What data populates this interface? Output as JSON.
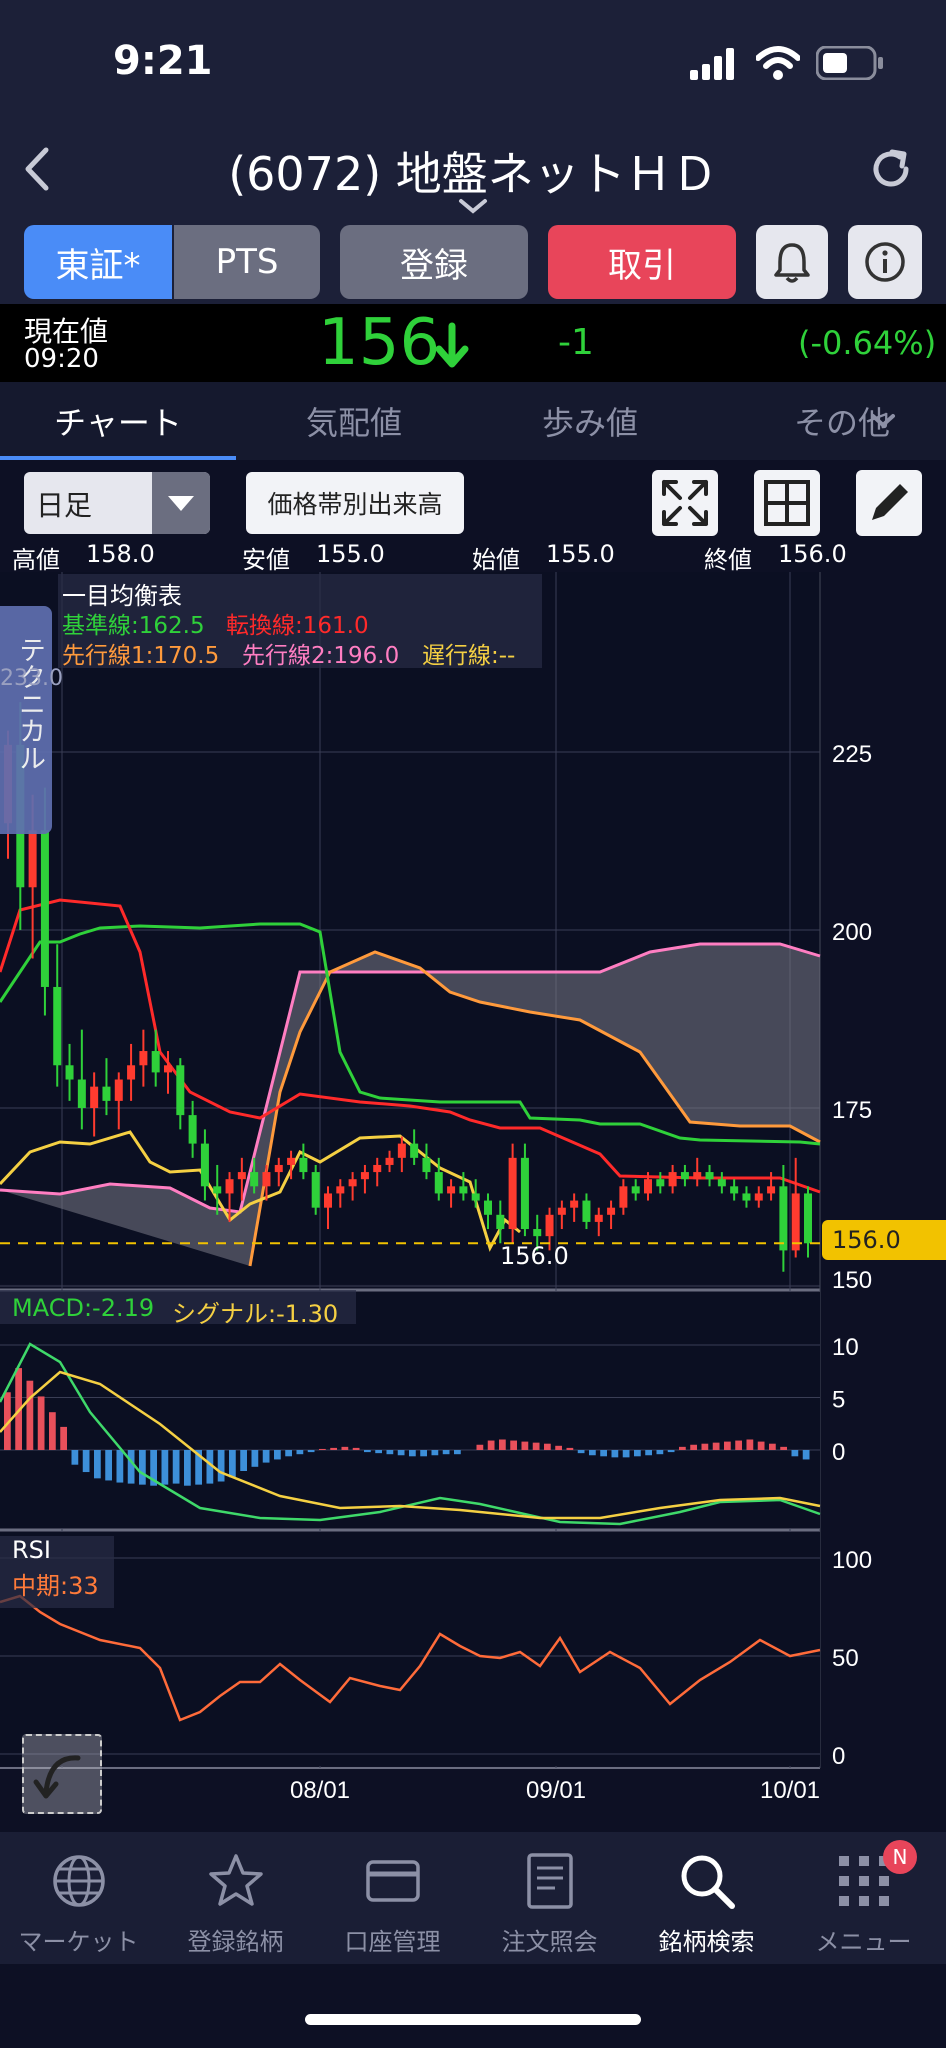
{
  "status_bar": {
    "time": "9:21"
  },
  "header": {
    "title": "(6072) 地盤ネットＨＤ"
  },
  "buttons": {
    "market": "東証*",
    "pts": "PTS",
    "register": "登録",
    "trade": "取引"
  },
  "price": {
    "label": "現在値",
    "time": "09:20",
    "value": "156",
    "change": "-1",
    "change_pct": "(-0.64%)"
  },
  "tabs": [
    "チャート",
    "気配値",
    "歩み値",
    "その他"
  ],
  "toolbar": {
    "period": "日足",
    "volume_btn": "価格帯別出来高"
  },
  "ohlc": {
    "high_label": "高値",
    "high": "158.0",
    "low_label": "安値",
    "low": "155.0",
    "open_label": "始値",
    "open": "155.0",
    "close_label": "終値",
    "close": "156.0"
  },
  "ichimoku": {
    "title": "一目均衡表",
    "kijun": "基準線:162.5",
    "tenkan": "転換線:161.0",
    "senkou1": "先行線1:170.5",
    "senkou2": "先行線2:196.0",
    "chikou": "遅行線:--"
  },
  "side_tab": {
    "label": "テクニカル",
    "value": "233.0"
  },
  "main_axis": [
    "225",
    "200",
    "175",
    "150"
  ],
  "current_price_tag": "156.0",
  "low_annotation": "156.0",
  "macd": {
    "label": "MACD:-2.19",
    "signal": "シグナル:-1.30",
    "axis": [
      "10",
      "5",
      "0"
    ]
  },
  "rsi": {
    "label": "RSI",
    "mid": "中期:33",
    "axis": [
      "100",
      "50",
      "0"
    ]
  },
  "x_labels": [
    "08/01",
    "09/01",
    "10/01"
  ],
  "bottom_nav": [
    {
      "label": "マーケット",
      "icon": "globe-icon"
    },
    {
      "label": "登録銘柄",
      "icon": "star-icon"
    },
    {
      "label": "口座管理",
      "icon": "card-icon"
    },
    {
      "label": "注文照会",
      "icon": "document-icon"
    },
    {
      "label": "銘柄検索",
      "icon": "search-icon"
    },
    {
      "label": "メニュー",
      "icon": "menu-grid-icon"
    }
  ],
  "menu_badge": "N",
  "colors": {
    "up": "#ff3b2f",
    "down": "#2fd13a",
    "kijun": "#2fd13a",
    "tenkan": "#ff2a2a",
    "senkou1": "#ff9a3c",
    "senkou2": "#ff7ec2",
    "chikou": "#f5d043",
    "macd_pos": "#e8505b",
    "macd_neg": "#3d8fd9",
    "accent_blue": "#4a8cf7",
    "trade_red": "#e8455a"
  },
  "chart_data": {
    "type": "candlestick",
    "ylim": [
      148,
      240
    ],
    "x_labels": [
      "08/01",
      "09/01",
      "10/01"
    ],
    "candles": [
      [
        215,
        228,
        210,
        226
      ],
      [
        226,
        232,
        200,
        206
      ],
      [
        206,
        219,
        196,
        214
      ],
      [
        214,
        220,
        188,
        192
      ],
      [
        192,
        198,
        178,
        181
      ],
      [
        181,
        184,
        176,
        179
      ],
      [
        179,
        186,
        172,
        175
      ],
      [
        175,
        180,
        171,
        178
      ],
      [
        178,
        182,
        174,
        176
      ],
      [
        176,
        180,
        172,
        179
      ],
      [
        179,
        184,
        176,
        181
      ],
      [
        181,
        186,
        178,
        183
      ],
      [
        183,
        186,
        178,
        180
      ],
      [
        180,
        183,
        177,
        181
      ],
      [
        181,
        182,
        172,
        174
      ],
      [
        174,
        176,
        168,
        170
      ],
      [
        170,
        172,
        162,
        164
      ],
      [
        164,
        167,
        160,
        163
      ],
      [
        163,
        166,
        159,
        165
      ],
      [
        165,
        168,
        162,
        166
      ],
      [
        166,
        168,
        163,
        164
      ],
      [
        164,
        167,
        162,
        166
      ],
      [
        166,
        168,
        164,
        167
      ],
      [
        167,
        169,
        165,
        168
      ],
      [
        168,
        170,
        165,
        166
      ],
      [
        166,
        167,
        160,
        161
      ],
      [
        161,
        164,
        158,
        163
      ],
      [
        163,
        165,
        161,
        164
      ],
      [
        164,
        166,
        162,
        165
      ],
      [
        165,
        167,
        163,
        166
      ],
      [
        166,
        168,
        164,
        167
      ],
      [
        167,
        169,
        166,
        168
      ],
      [
        168,
        171,
        166,
        170
      ],
      [
        170,
        172,
        167,
        168
      ],
      [
        168,
        170,
        165,
        166
      ],
      [
        166,
        168,
        162,
        163
      ],
      [
        163,
        165,
        161,
        164
      ],
      [
        164,
        166,
        162,
        163
      ],
      [
        163,
        165,
        161,
        162
      ],
      [
        162,
        163,
        158,
        160
      ],
      [
        160,
        162,
        156,
        158
      ],
      [
        158,
        170,
        156,
        168
      ],
      [
        168,
        170,
        157,
        158
      ],
      [
        158,
        160,
        155,
        157
      ],
      [
        157,
        161,
        155,
        160
      ],
      [
        160,
        162,
        158,
        161
      ],
      [
        161,
        163,
        159,
        162
      ],
      [
        162,
        163,
        158,
        159
      ],
      [
        159,
        161,
        157,
        160
      ],
      [
        160,
        162,
        158,
        161
      ],
      [
        161,
        165,
        160,
        164
      ],
      [
        164,
        165,
        162,
        163
      ],
      [
        163,
        166,
        162,
        165
      ],
      [
        165,
        166,
        163,
        164
      ],
      [
        164,
        167,
        163,
        166
      ],
      [
        166,
        167,
        164,
        165
      ],
      [
        165,
        168,
        164,
        166
      ],
      [
        166,
        167,
        164,
        165
      ],
      [
        165,
        166,
        163,
        164
      ],
      [
        164,
        165,
        162,
        163
      ],
      [
        163,
        164,
        161,
        162
      ],
      [
        162,
        164,
        161,
        163
      ],
      [
        163,
        166,
        162,
        164
      ],
      [
        164,
        167,
        152,
        155
      ],
      [
        155,
        168,
        154,
        163
      ],
      [
        163,
        164,
        154,
        156
      ]
    ],
    "kijun": [
      200,
      200,
      201,
      201,
      202,
      202,
      203,
      203,
      203,
      203,
      203,
      203,
      203,
      203,
      203,
      203,
      203,
      203,
      203,
      203,
      203,
      203,
      203,
      203,
      203,
      203,
      203,
      203,
      203,
      203,
      203,
      195,
      180,
      175,
      175,
      175,
      175,
      175,
      175,
      175,
      175,
      175,
      175,
      175,
      175,
      175,
      175,
      175,
      175,
      173,
      173,
      173,
      173,
      173,
      172,
      172,
      172,
      172,
      172,
      172,
      172,
      172,
      167,
      167,
      167,
      166,
      166,
      166,
      166,
      166,
      166,
      166,
      166,
      166,
      166,
      166,
      166,
      166,
      166,
      166,
      166,
      165,
      165,
      165,
      165,
      166,
      167,
      167,
      167,
      167,
      167,
      166,
      166,
      165,
      163,
      162
    ],
    "tenkan": [
      200,
      203,
      204,
      204,
      204,
      202,
      202,
      201,
      200,
      200,
      188,
      180,
      178,
      178,
      178,
      177,
      176,
      176,
      175,
      175,
      175,
      175,
      175,
      175,
      176,
      177,
      178,
      179,
      179,
      179,
      179,
      179,
      178,
      177,
      176,
      175,
      175,
      175,
      175,
      175,
      175,
      175,
      174,
      174,
      174,
      174,
      173,
      173,
      173,
      172,
      172,
      170,
      168,
      165,
      164,
      164,
      164,
      164,
      164,
      164,
      164,
      164,
      164,
      164,
      164,
      164,
      164,
      164,
      164,
      164,
      164,
      165,
      165,
      165,
      165,
      165,
      165,
      165,
      165,
      164,
      164,
      164,
      164,
      164,
      164,
      164,
      164,
      164,
      164,
      163,
      163,
      163,
      162,
      162,
      162,
      161
    ],
    "senkou1": [
      194,
      194,
      194,
      194,
      194,
      194,
      194,
      194,
      194,
      194,
      194,
      194,
      194,
      194,
      194,
      194,
      194,
      194,
      194,
      194,
      194,
      194,
      194,
      194,
      194,
      194,
      194,
      194,
      194,
      194,
      194,
      194,
      194,
      194,
      194,
      194,
      194,
      194,
      194,
      194,
      194,
      194,
      194,
      194,
      194,
      194,
      194,
      194,
      194,
      194,
      194,
      194,
      194,
      194,
      194,
      194,
      194,
      194,
      194,
      194,
      194,
      194,
      194,
      194,
      194,
      194,
      194,
      194,
      194,
      194,
      194,
      194,
      194,
      194,
      194,
      194,
      194,
      194,
      194,
      194,
      194,
      194,
      194,
      194,
      194,
      194,
      194,
      194,
      194,
      194,
      194,
      194,
      194,
      194,
      194,
      194
    ],
    "chikou": [
      178,
      182,
      184,
      183,
      181,
      185,
      180,
      176,
      175,
      172,
      168,
      160,
      158,
      162,
      165,
      166,
      163,
      160,
      158,
      154,
      156,
      160,
      168,
      170,
      169,
      168,
      168,
      167,
      166,
      165,
      163,
      164,
      166,
      164,
      162,
      160,
      158,
      154,
      150,
      152,
      155,
      158
    ]
  }
}
